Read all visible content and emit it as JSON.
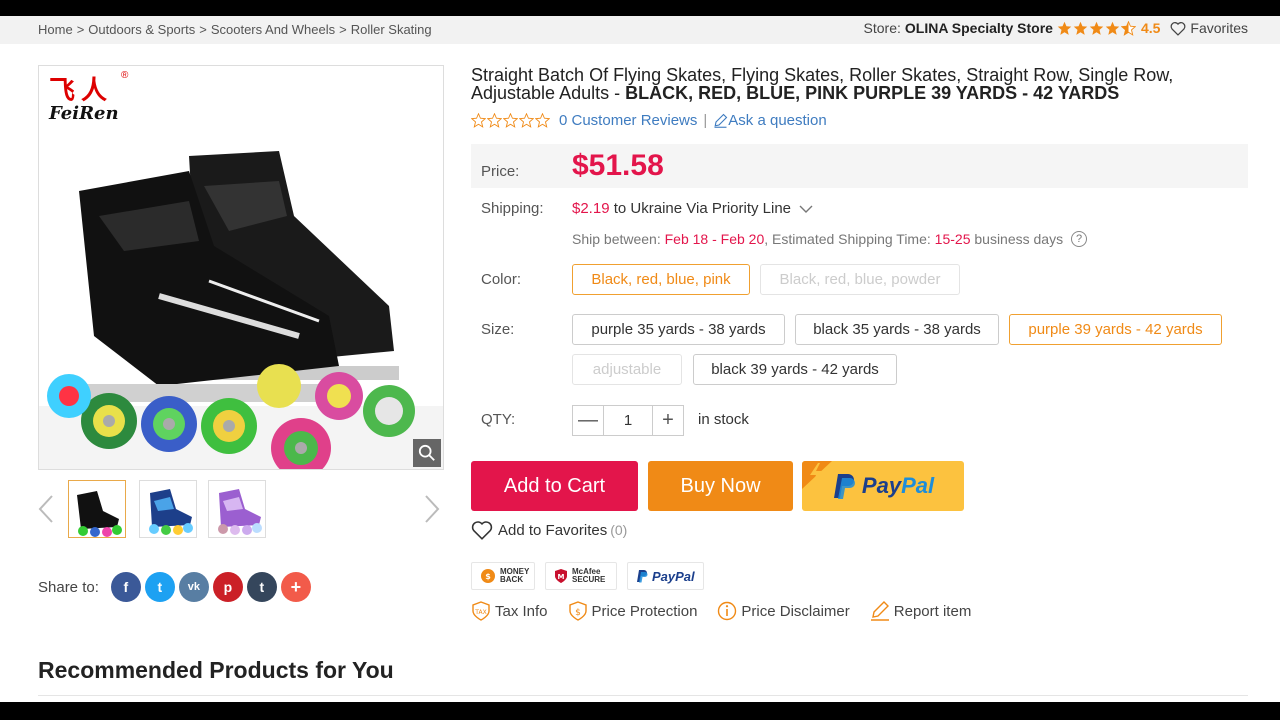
{
  "breadcrumb": {
    "items": [
      "Home",
      "Outdoors & Sports",
      "Scooters And Wheels",
      "Roller Skating"
    ],
    "separator": ">"
  },
  "store": {
    "label": "Store:",
    "name": "OLINA Specialty Store",
    "rating": "4.5",
    "favorites": "Favorites"
  },
  "product": {
    "brand_cn": "飞人",
    "brand_en": "FeiRen",
    "brand_reg": "®",
    "title_plain": "Straight Batch Of Flying Skates, Flying Skates, Roller Skates, Straight Row, Single Row, Adjustable Adults - ",
    "title_bold": "BLACK, RED, BLUE, PINK PURPLE 39 YARDS - 42 YARDS",
    "reviews": "0 Customer Reviews",
    "review_divider": "|",
    "ask": "Ask a question",
    "review_stars": 0
  },
  "price": {
    "label": "Price:",
    "value": "$51.58"
  },
  "shipping": {
    "label": "Shipping:",
    "cost": "$2.19",
    "destination": "to Ukraine Via Priority Line",
    "between_label": "Ship between:",
    "dates": "Feb 18 - Feb 20",
    "est_label": ", Estimated Shipping Time:",
    "est_days": "15-25",
    "days_label": "business days",
    "help_icon": "?"
  },
  "color": {
    "label": "Color:",
    "options": [
      {
        "label": "Black, red, blue, pink",
        "state": "selected"
      },
      {
        "label": "Black, red, blue, powder",
        "state": "disabled"
      }
    ]
  },
  "size": {
    "label": "Size:",
    "options": [
      {
        "label": "purple 35 yards - 38 yards",
        "state": "normal"
      },
      {
        "label": "black 35 yards - 38 yards",
        "state": "normal"
      },
      {
        "label": "purple 39 yards - 42 yards",
        "state": "selected"
      },
      {
        "label": "adjustable",
        "state": "disabled"
      },
      {
        "label": "black 39 yards - 42 yards",
        "state": "normal"
      }
    ]
  },
  "qty": {
    "label": "QTY:",
    "value": "1",
    "stock": "in stock"
  },
  "buttons": {
    "add_to_cart": "Add to Cart",
    "buy_now": "Buy Now",
    "paypal_p": "Pay",
    "paypal_pal": "Pal",
    "add_fav": "Add to Favorites",
    "fav_count": "(0)"
  },
  "badges": {
    "money_back": "MONEY BACK",
    "mcafee": "McAfee SECURE",
    "paypal": "PayPal"
  },
  "info_links": {
    "tax": "Tax Info",
    "protection": "Price Protection",
    "disclaimer": "Price Disclaimer",
    "report": "Report item"
  },
  "share": {
    "label": "Share to:",
    "networks": [
      "f",
      "t",
      "vk",
      "p",
      "t",
      "+"
    ]
  },
  "recommended": {
    "title": "Recommended Products for You"
  },
  "colors": {
    "price_red": "#e3154b",
    "orange": "#f08a16",
    "link_blue": "#3f7cc0",
    "paypal_yellow": "#fcc23f"
  }
}
